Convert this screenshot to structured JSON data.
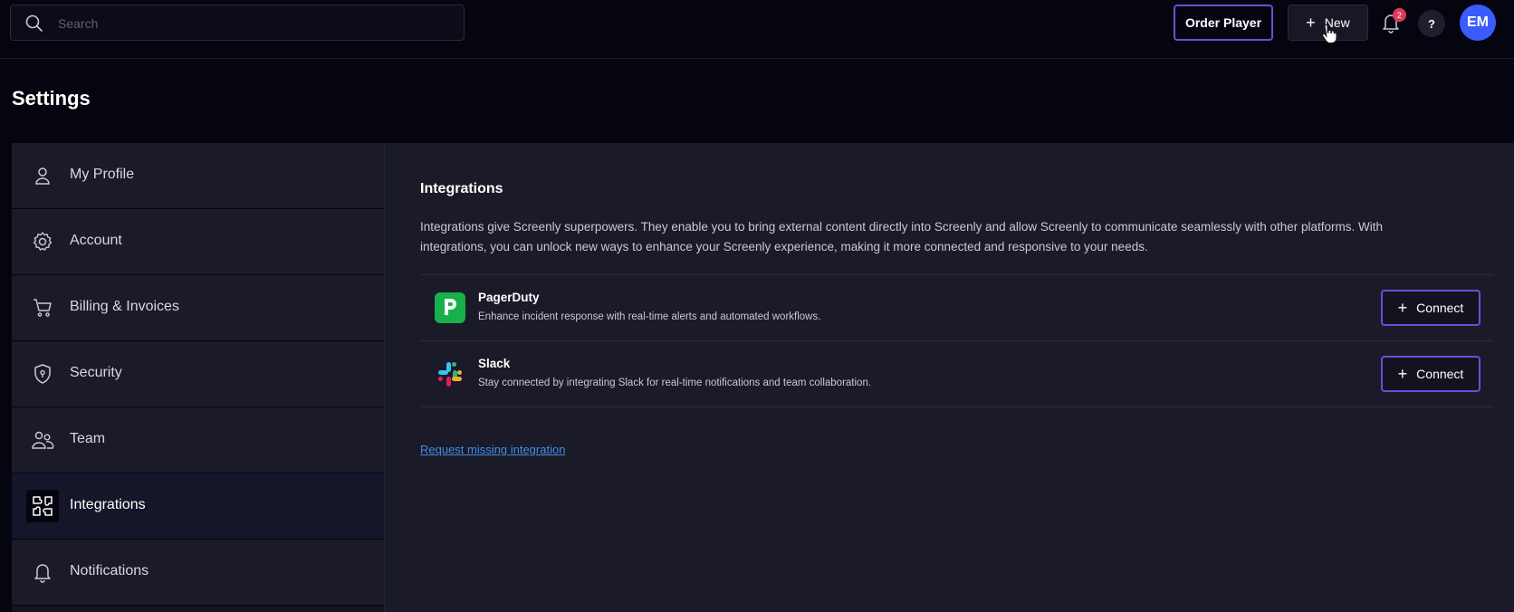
{
  "header": {
    "search_placeholder": "Search",
    "order_player_label": "Order Player",
    "new_label": "New",
    "notification_count": "2",
    "help_label": "?",
    "avatar_initials": "EM"
  },
  "page": {
    "title": "Settings"
  },
  "sidebar": {
    "items": [
      {
        "label": "My Profile",
        "icon": "user-icon"
      },
      {
        "label": "Account",
        "icon": "gear-icon"
      },
      {
        "label": "Billing & Invoices",
        "icon": "cart-icon"
      },
      {
        "label": "Security",
        "icon": "shield-icon"
      },
      {
        "label": "Team",
        "icon": "team-icon"
      },
      {
        "label": "Integrations",
        "icon": "integrations-icon",
        "active": true
      },
      {
        "label": "Notifications",
        "icon": "bell-icon"
      }
    ]
  },
  "main": {
    "title": "Integrations",
    "description": "Integrations give Screenly superpowers. They enable you to bring external content directly into Screenly and allow Screenly to communicate seamlessly with other platforms. With integrations, you can unlock new ways to enhance your Screenly experience, making it more connected and responsive to your needs.",
    "integrations": [
      {
        "name": "PagerDuty",
        "description": "Enhance incident response with real-time alerts and automated workflows.",
        "button": "Connect",
        "logo_letter": "P"
      },
      {
        "name": "Slack",
        "description": "Stay connected by integrating Slack for real-time notifications and team collaboration.",
        "button": "Connect"
      }
    ],
    "request_link": "Request missing integration"
  },
  "colors": {
    "accent_border": "#6a4fd8",
    "avatar_bg": "#3b5bff",
    "badge_bg": "#e0395a",
    "link": "#3f8fe6",
    "pagerduty_green": "#17b14b"
  }
}
